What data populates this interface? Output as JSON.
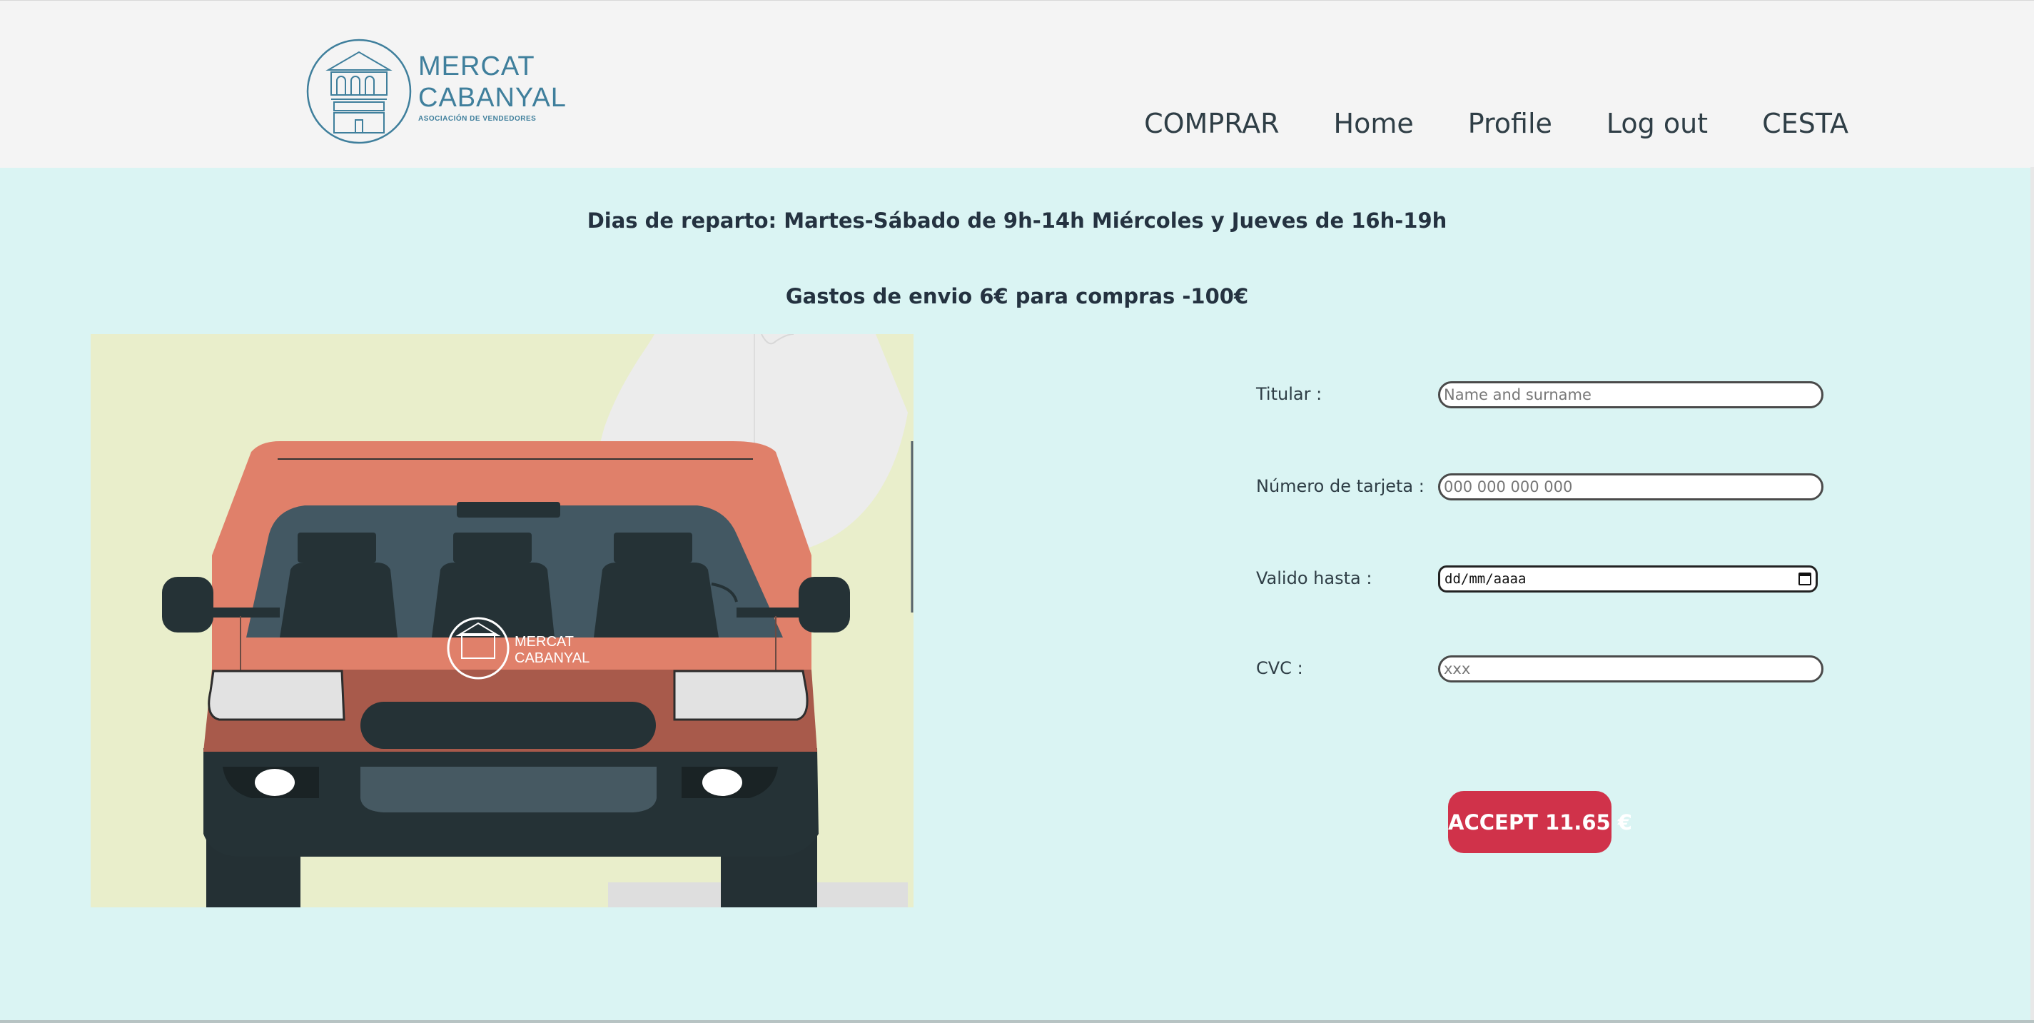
{
  "header": {
    "logo": {
      "line1": "MERCAT",
      "line2": "CABANYAL",
      "subtitle": "ASOCIACIÓN DE VENDEDORES"
    },
    "nav": [
      {
        "label": "COMPRAR"
      },
      {
        "label": "Home"
      },
      {
        "label": "Profile"
      },
      {
        "label": "Log out"
      },
      {
        "label": "CESTA"
      }
    ]
  },
  "main": {
    "notice_delivery": "Dias de reparto: Martes-Sábado de 9h-14h Miércoles y Jueves de 16h-19h",
    "notice_shipping": "Gastos de envio 6€ para compras -100€",
    "van": {
      "brand_line1": "MERCAT",
      "brand_line2": "CABANYAL"
    },
    "form": {
      "holder": {
        "label": "Titular :",
        "placeholder": "Name and surname"
      },
      "card_number": {
        "label": "Número de tarjeta :",
        "placeholder": "000 000 000 000"
      },
      "valid_until": {
        "label": "Valido hasta :",
        "placeholder": "dd/mm/aaaa"
      },
      "cvc": {
        "label": "CVC :",
        "placeholder": "xxx"
      },
      "accept_button": "ACCEPT 11.65 €"
    }
  },
  "colors": {
    "background": "#daf4f3",
    "header": "#f4f4f4",
    "accent_button": "#d0324a",
    "van_body": "#e0806a",
    "logo": "#3f7f9c"
  }
}
